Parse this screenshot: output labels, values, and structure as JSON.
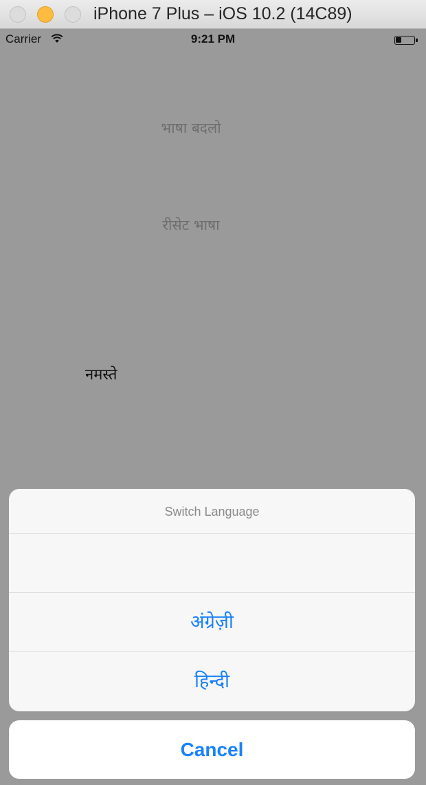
{
  "window": {
    "title": "iPhone 7 Plus – iOS 10.2 (14C89)"
  },
  "status_bar": {
    "carrier": "Carrier",
    "time": "9:21 PM",
    "wifi_icon": "wifi-icon",
    "battery_icon": "battery-icon",
    "battery_level": 0.3
  },
  "screen": {
    "change_language_button": "भाषा बदलो",
    "reset_language_button": "रीसेट भाषा",
    "greeting": "नमस्ते"
  },
  "action_sheet": {
    "title": "Switch Language",
    "options": [
      {
        "label": ""
      },
      {
        "label": "अंग्रेज़ी"
      },
      {
        "label": "हिन्दी"
      }
    ],
    "cancel_label": "Cancel"
  },
  "colors": {
    "accent": "#1a82fb",
    "dim_overlay": "#9a9a9a",
    "sheet_background": "#f7f7f7"
  }
}
